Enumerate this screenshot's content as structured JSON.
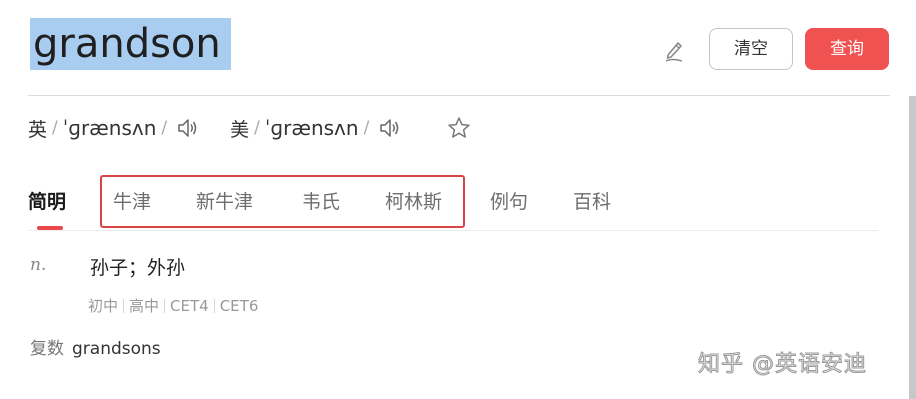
{
  "search": {
    "word": "grandson",
    "clear_label": "清空",
    "query_label": "查询",
    "edit_icon": "pencil-icon"
  },
  "colors": {
    "accent": "#f05252",
    "selection": "#a8cdf0",
    "tab_underline": "#e8484a",
    "highlight_box": "#d94545"
  },
  "pronunciation": {
    "uk": {
      "region": "英",
      "phonetic": "ˈɡrænsʌn",
      "icon": "speaker-icon"
    },
    "us": {
      "region": "美",
      "phonetic": "ˈɡrænsʌn",
      "icon": "speaker-icon"
    },
    "favorite_icon": "star-icon"
  },
  "tabs": [
    {
      "label": "简明",
      "active": true
    },
    {
      "label": "牛津",
      "active": false
    },
    {
      "label": "新牛津",
      "active": false
    },
    {
      "label": "韦氏",
      "active": false
    },
    {
      "label": "柯林斯",
      "active": false
    },
    {
      "label": "例句",
      "active": false
    },
    {
      "label": "百科",
      "active": false
    }
  ],
  "entry": {
    "pos": "n.",
    "definition": "孙子；外孙",
    "levels": [
      "初中",
      "高中",
      "CET4",
      "CET6"
    ],
    "plural_label": "复数",
    "plural_word": "grandsons"
  },
  "watermark": "知乎 @英语安迪"
}
